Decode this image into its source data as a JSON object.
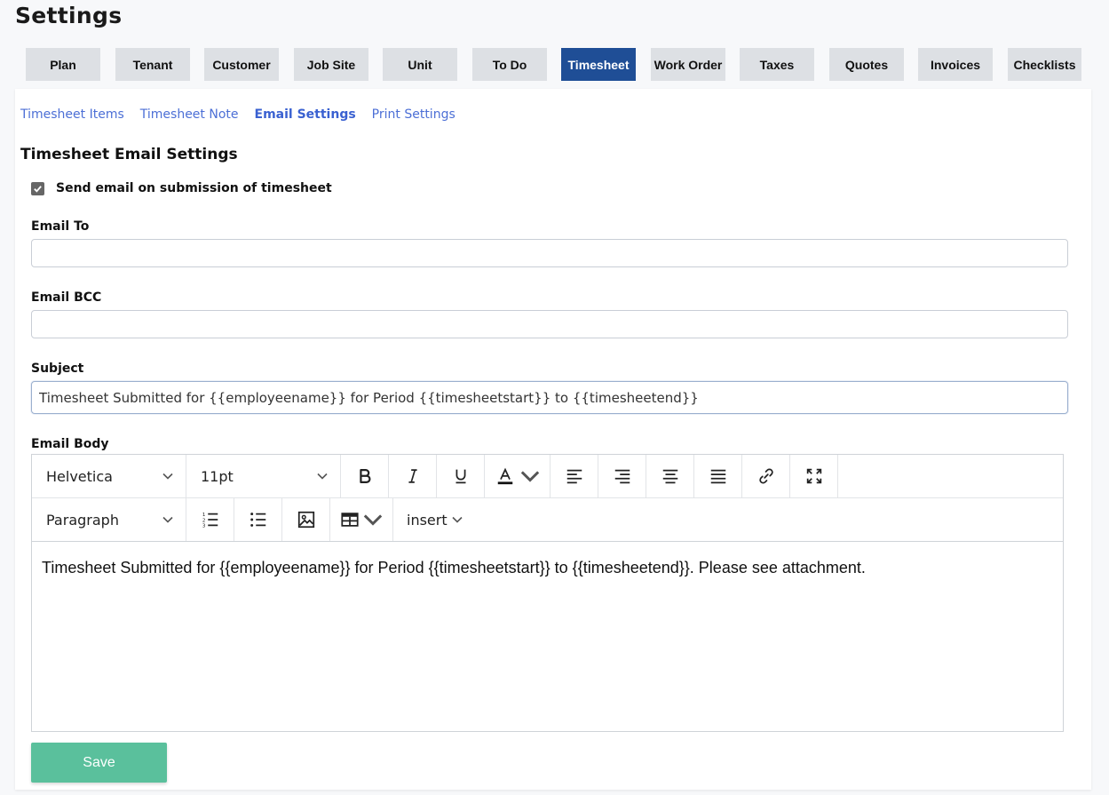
{
  "page": {
    "title": "Settings"
  },
  "main_tabs": [
    {
      "label": "Plan"
    },
    {
      "label": "Tenant"
    },
    {
      "label": "Customer"
    },
    {
      "label": "Job Site"
    },
    {
      "label": "Unit"
    },
    {
      "label": "To Do"
    },
    {
      "label": "Timesheet",
      "active": true
    },
    {
      "label": "Work Order"
    },
    {
      "label": "Taxes"
    },
    {
      "label": "Quotes"
    },
    {
      "label": "Invoices"
    },
    {
      "label": "Checklists"
    }
  ],
  "sub_tabs": [
    {
      "label": "Timesheet Items"
    },
    {
      "label": "Timesheet Note"
    },
    {
      "label": "Email Settings",
      "active": true
    },
    {
      "label": "Print Settings"
    }
  ],
  "section": {
    "title": "Timesheet Email Settings"
  },
  "send_email": {
    "label": "Send email on submission of timesheet",
    "checked": true
  },
  "email_to": {
    "label": "Email To",
    "value": ""
  },
  "email_bcc": {
    "label": "Email BCC",
    "value": ""
  },
  "subject": {
    "label": "Subject",
    "value": "Timesheet Submitted for {{employeename}} for Period {{timesheetstart}} to {{timesheetend}}"
  },
  "email_body": {
    "label": "Email Body",
    "font_family": "Helvetica",
    "font_size": "11pt",
    "block_format": "Paragraph",
    "insert_label": "insert",
    "content": "Timesheet Submitted for {{employeename}} for Period {{timesheetstart}} to {{timesheetend}}. Please see attachment."
  },
  "actions": {
    "save_label": "Save"
  },
  "colors": {
    "accent": "#1f4e96",
    "link": "#4c6fd6",
    "save": "#5ac09c",
    "tab_bg": "#dde0e4"
  },
  "toolbar_icons": [
    "bold-icon",
    "italic-icon",
    "underline-icon",
    "text-color-icon",
    "align-left-icon",
    "align-right-icon",
    "align-center-icon",
    "align-justify-icon",
    "link-icon",
    "fullscreen-icon",
    "ordered-list-icon",
    "bullet-list-icon",
    "image-icon",
    "table-icon"
  ]
}
